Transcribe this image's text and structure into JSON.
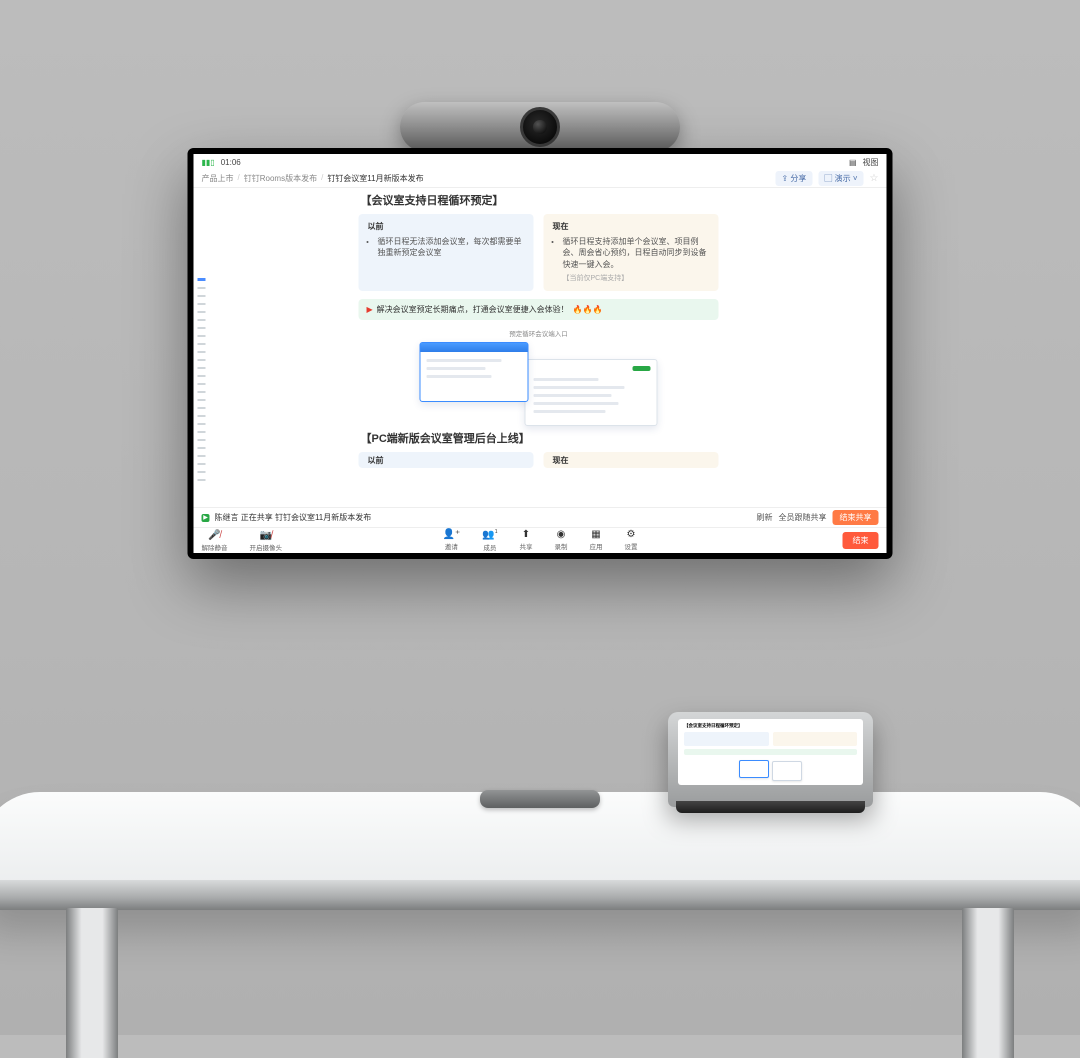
{
  "statusbar": {
    "time": "01:06",
    "signal_icon": "▮▮▯",
    "view_icon": "▤",
    "view_label": "视图"
  },
  "breadcrumb": {
    "items": [
      "产品上市",
      "钉钉Rooms版本发布",
      "钉钉会议室11月新版本发布"
    ],
    "sep": "/"
  },
  "header_tools": {
    "share": "分享",
    "present": "演示",
    "star": "☆"
  },
  "doc": {
    "section1_title": "【会议室支持日程循环预定】",
    "before_label": "以前",
    "before_item": "循环日程无法添加会议室，每次都需要单独重新预定会议室",
    "after_label": "现在",
    "after_item": "循环日程支持添加单个会议室、项目例会、周会省心预约，日程自动同步到设备快速一键入会。",
    "after_note": "【当前仅PC端支持】",
    "highlight": "解决会议室预定长期痛点，打通会议室便捷入会体验！",
    "fire": "🔥🔥🔥",
    "figure_caption": "预定循环会议端入口",
    "section2_title": "【PC端新版会议室管理后台上线】",
    "before_label2": "以前",
    "after_label2": "现在"
  },
  "sharebar": {
    "presenter": "陈继言",
    "status": "正在共享 钉钉会议室11月新版本发布",
    "refresh": "刷新",
    "follow": "全员跟随共享",
    "stop": "结束共享"
  },
  "controls": {
    "mute": "解除静音",
    "camera": "开启摄像头",
    "invite": "邀请",
    "members": "成员",
    "members_count": "1",
    "share": "共享",
    "record": "录制",
    "apps": "应用",
    "settings": "设置",
    "end": "结束"
  }
}
